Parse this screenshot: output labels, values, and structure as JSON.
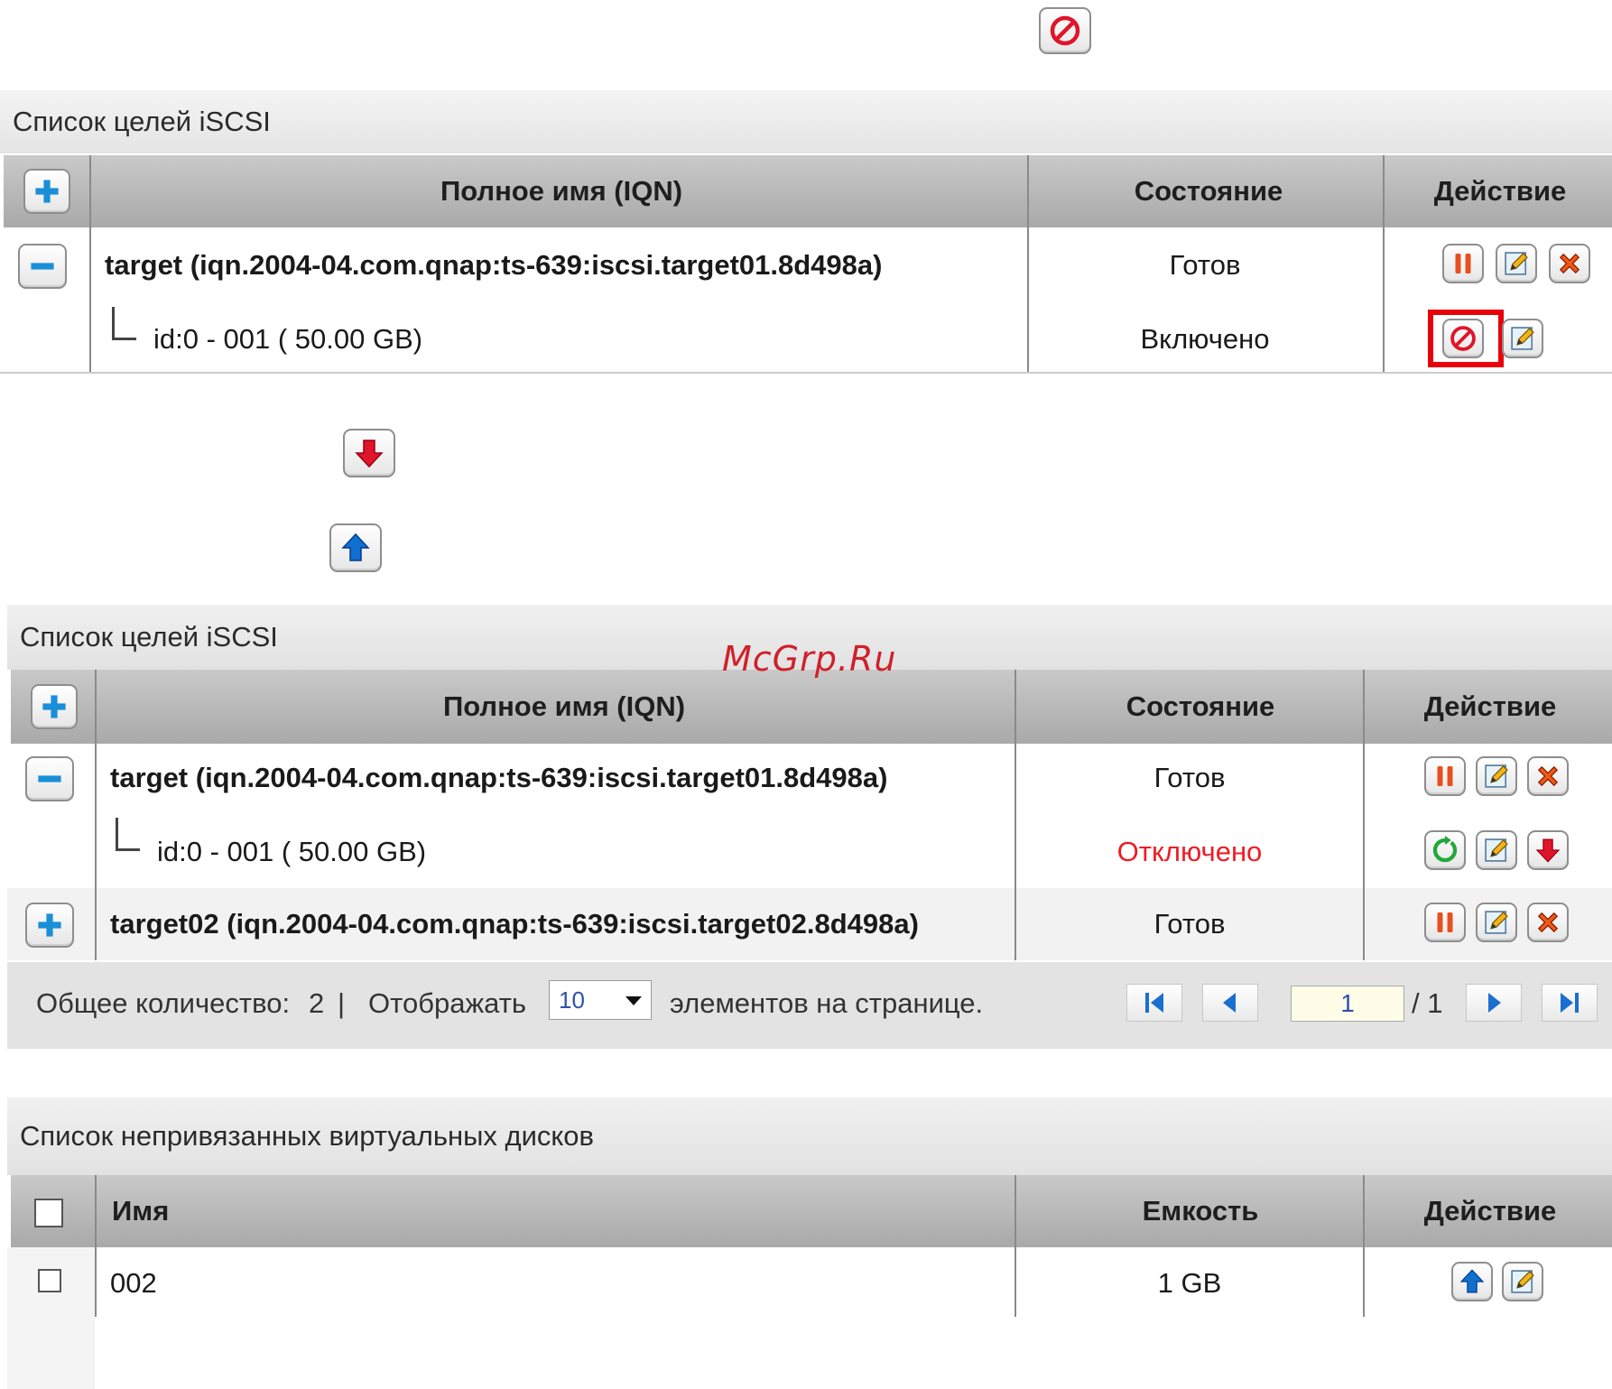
{
  "watermark": "McGrp.Ru",
  "panel1": {
    "title": "Список целей iSCSI",
    "columns": {
      "name": "Полное имя (IQN)",
      "status": "Состояние",
      "action": "Действие"
    },
    "target": {
      "name": "target (iqn.2004-04.com.qnap:ts-639:iscsi.target01.8d498a)",
      "status": "Готов"
    },
    "lun": {
      "name": "id:0 - 001 ( 50.00 GB)",
      "status": "Включено"
    }
  },
  "panel2": {
    "title": "Список целей iSCSI",
    "columns": {
      "name": "Полное имя (IQN)",
      "status": "Состояние",
      "action": "Действие"
    },
    "rows": [
      {
        "name": "target (iqn.2004-04.com.qnap:ts-639:iscsi.target01.8d498a)",
        "status": "Готов"
      },
      {
        "name": "id:0 - 001 ( 50.00 GB)",
        "status": "Отключено"
      },
      {
        "name": "target02 (iqn.2004-04.com.qnap:ts-639:iscsi.target02.8d498a)",
        "status": "Готов"
      }
    ],
    "footer": {
      "total_label": "Общее количество:",
      "total_value": "2",
      "separator": "|",
      "display_label": "Отображать",
      "per_page": "10",
      "per_page_suffix": "элементов на странице.",
      "page": "1",
      "page_total": "/ 1"
    }
  },
  "panel3": {
    "title": "Список непривязанных виртуальных дисков",
    "columns": {
      "name": "Имя",
      "capacity": "Емкость",
      "action": "Действие"
    },
    "rows": [
      {
        "name": "002",
        "capacity": "1 GB"
      }
    ]
  },
  "icons": {
    "disable": "disable-icon",
    "move_down": "arrow-down-icon",
    "move_up": "arrow-up-icon",
    "add": "plus-icon",
    "collapse": "minus-icon",
    "stop": "pause-icon",
    "edit": "edit-icon",
    "delete": "delete-icon",
    "enable": "refresh-icon"
  },
  "colors": {
    "header_bg": "#b5b5b5",
    "disabled_text": "#ee1c24",
    "highlight": "#e8000b",
    "add_blue": "#1a8fd8"
  }
}
